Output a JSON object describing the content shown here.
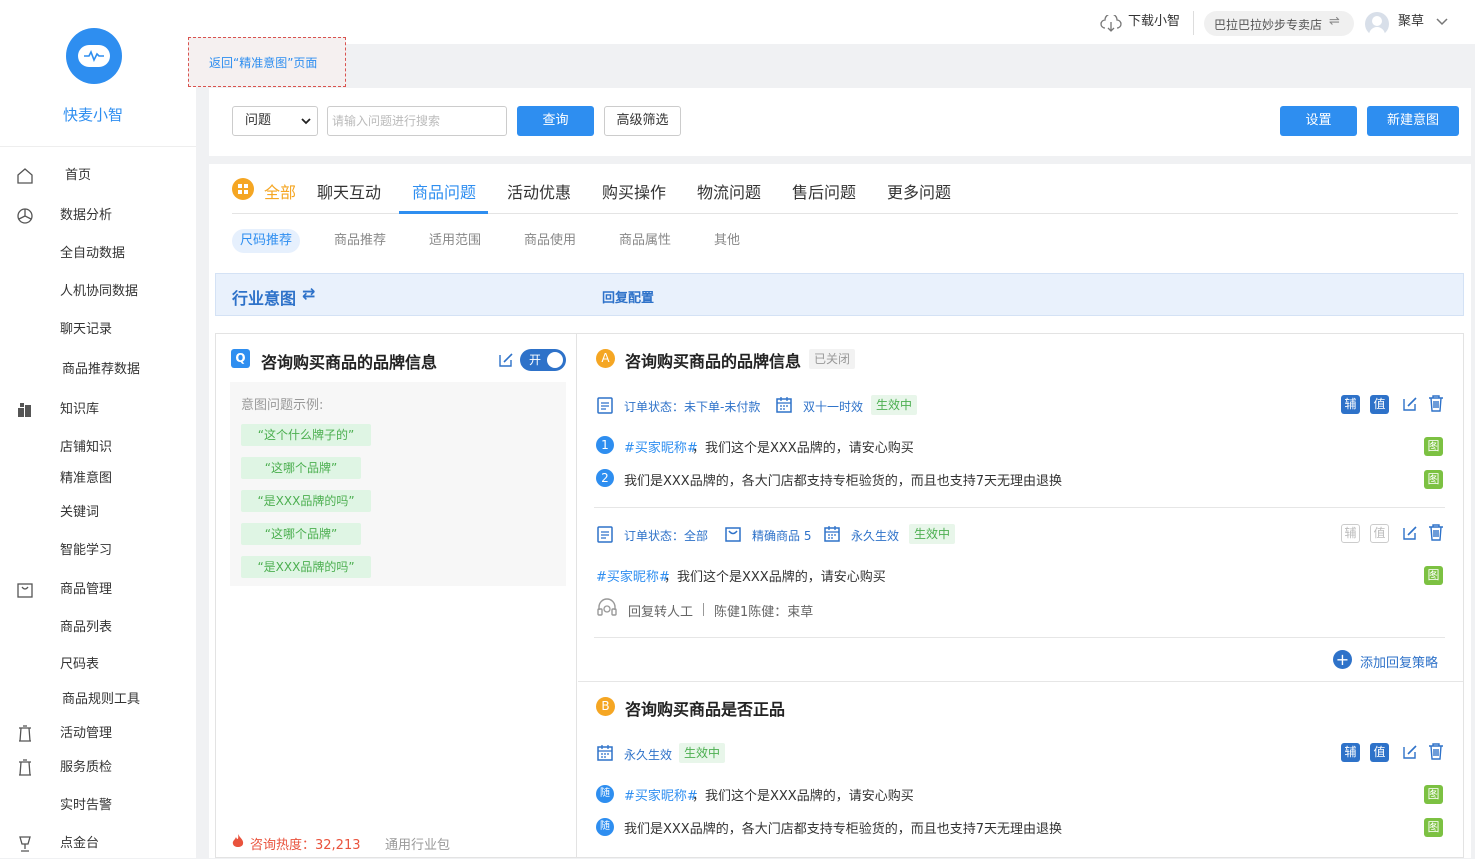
{
  "app": {
    "name": "快麦小智"
  },
  "sidebar": {
    "items": [
      {
        "label": "首页",
        "icon": "home-icon",
        "top": 0
      },
      {
        "label": "数据分析",
        "icon": "chart-icon"
      },
      {
        "label": "全自动数据"
      },
      {
        "label": "人机协同数据"
      },
      {
        "label": "聊天记录"
      },
      {
        "label": "商品推荐数据"
      },
      {
        "label": "知识库",
        "icon": "book-icon"
      },
      {
        "label": "店铺知识"
      },
      {
        "label": "精准意图"
      },
      {
        "label": "关键词"
      },
      {
        "label": "智能学习"
      },
      {
        "label": "商品管理",
        "icon": "bag-icon"
      },
      {
        "label": "商品列表"
      },
      {
        "label": "尺码表"
      },
      {
        "label": "商品规则工具"
      },
      {
        "label": "活动管理",
        "icon": "lantern-icon"
      },
      {
        "label": "服务质检",
        "icon": "lantern-icon"
      },
      {
        "label": "实时告警"
      },
      {
        "label": "点金台",
        "icon": "trophy-icon"
      }
    ]
  },
  "topbar": {
    "download": "下载小智",
    "shop": "巴拉巴拉妙步专卖店",
    "user": "聚草"
  },
  "back_link": "返回“精准意图”页面",
  "filter": {
    "select_value": "问题",
    "search_placeholder": "请输入问题进行搜索",
    "query_btn": "查询",
    "advanced_btn": "高级筛选",
    "settings_btn": "设置",
    "new_btn": "新建意图"
  },
  "tabs": [
    "全部",
    "聊天互动",
    "商品问题",
    "活动优惠",
    "购买操作",
    "物流问题",
    "售后问题",
    "更多问题"
  ],
  "subtabs": [
    "尺码推荐",
    "商品推荐",
    "适用范围",
    "商品使用",
    "商品属性",
    "其他"
  ],
  "band": {
    "industry": "行业意图",
    "reply": "回复配置"
  },
  "left": {
    "title": "咨询购买商品的品牌信息",
    "toggle": "开",
    "examples_label": "意图问题示例:",
    "examples": [
      "“这个什么牌子的”",
      "“这哪个品牌”",
      "“是XXX品牌的吗”",
      "“这哪个品牌”",
      "“是XXX品牌的吗”"
    ],
    "heat": "咨询热度：32,213",
    "pkg": "通用行业包"
  },
  "right": {
    "a": {
      "badge": "A",
      "title": "咨询购买商品的品牌信息",
      "status": "已关闭",
      "s1": {
        "order": "订单状态：未下单-未付款",
        "time": "双十一时效",
        "state": "生效中",
        "r1_mark": "#买家昵称#",
        "r1_text": "，我们这个是XXX品牌的，请安心购买",
        "r2_text": "我们是XXX品牌的，各大门店都支持专柜验货的，而且也支持7天无理由退换"
      },
      "s2": {
        "order": "订单状态：全部",
        "goods": "精确商品 5",
        "time": "永久生效",
        "state": "生效中",
        "r1_mark": "#买家昵称#",
        "r1_text": "，我们这个是XXX品牌的，请安心购买",
        "transfer": "回复转人工",
        "agents": "陈健1陈健：束草"
      },
      "add": "添加回复策略"
    },
    "b": {
      "badge": "B",
      "title": "咨询购买商品是否正品",
      "time": "永久生效",
      "state": "生效中",
      "r1_mark": "#买家昵称#",
      "r1_text": "，我们这个是XXX品牌的，请安心购买",
      "r2_text": "我们是XXX品牌的，各大门店都支持专柜验货的，而且也支持7天无理由退换"
    },
    "labels": {
      "fu": "辅",
      "zhi": "值",
      "tu": "图",
      "sui": "随",
      "n1": "1",
      "n2": "2"
    }
  },
  "colors": {
    "primary": "#2e8ef0",
    "dark_blue": "#2e72c9",
    "green": "#7cc142",
    "orange": "#f5a623"
  }
}
